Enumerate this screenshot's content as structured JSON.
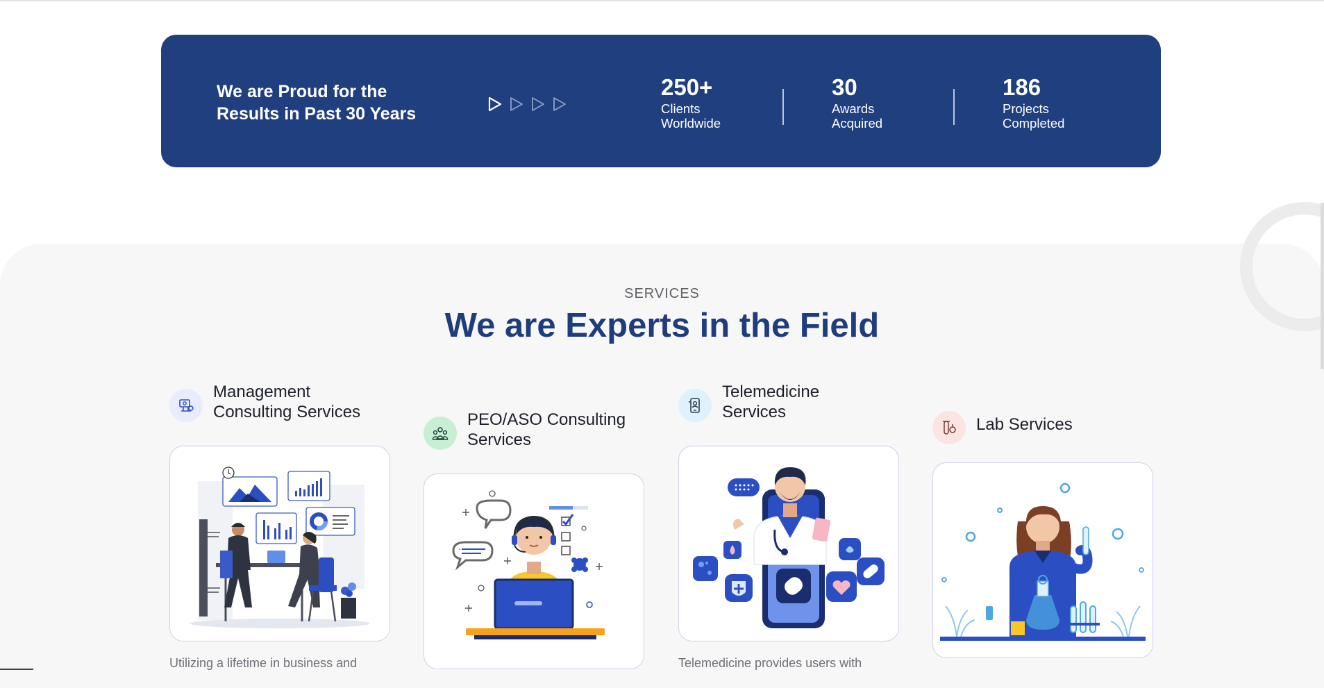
{
  "banner": {
    "headline_line1": "We are Proud for the",
    "headline_line2": "Results in Past 30 Years",
    "stats": [
      {
        "value": "250+",
        "label_line1": "Clients",
        "label_line2": "Worldwide"
      },
      {
        "value": "30",
        "label_line1": "Awards",
        "label_line2": "Acquired"
      },
      {
        "value": "186",
        "label_line1": "Projects",
        "label_line2": "Completed"
      }
    ]
  },
  "services": {
    "eyebrow": "SERVICES",
    "title": "We are Experts in the Field",
    "items": [
      {
        "title_line1": "Management",
        "title_line2": "Consulting Services",
        "icon": "consulting-icon",
        "icon_bg": "#e9ecfb",
        "description": "Utilizing a lifetime in business and"
      },
      {
        "title_line1": "PEO/ASO Consulting",
        "title_line2": "Services",
        "icon": "team-icon",
        "icon_bg": "#c8efd3",
        "description": ""
      },
      {
        "title_line1": "Telemedicine",
        "title_line2": "Services",
        "icon": "mobile-doctor-icon",
        "icon_bg": "#dff1fb",
        "description": "Telemedicine provides users with"
      },
      {
        "title_line1": "Lab Services",
        "title_line2": "",
        "icon": "test-tube-icon",
        "icon_bg": "#fbe5e3",
        "description": ""
      }
    ]
  },
  "colors": {
    "banner_bg": "#203f7f",
    "title_blue": "#1f3c7d",
    "section_bg": "#f7f7f7",
    "accent_blue": "#2b4fc2",
    "accent_orange": "#f7a21b",
    "accent_yellow": "#f9c72a"
  }
}
